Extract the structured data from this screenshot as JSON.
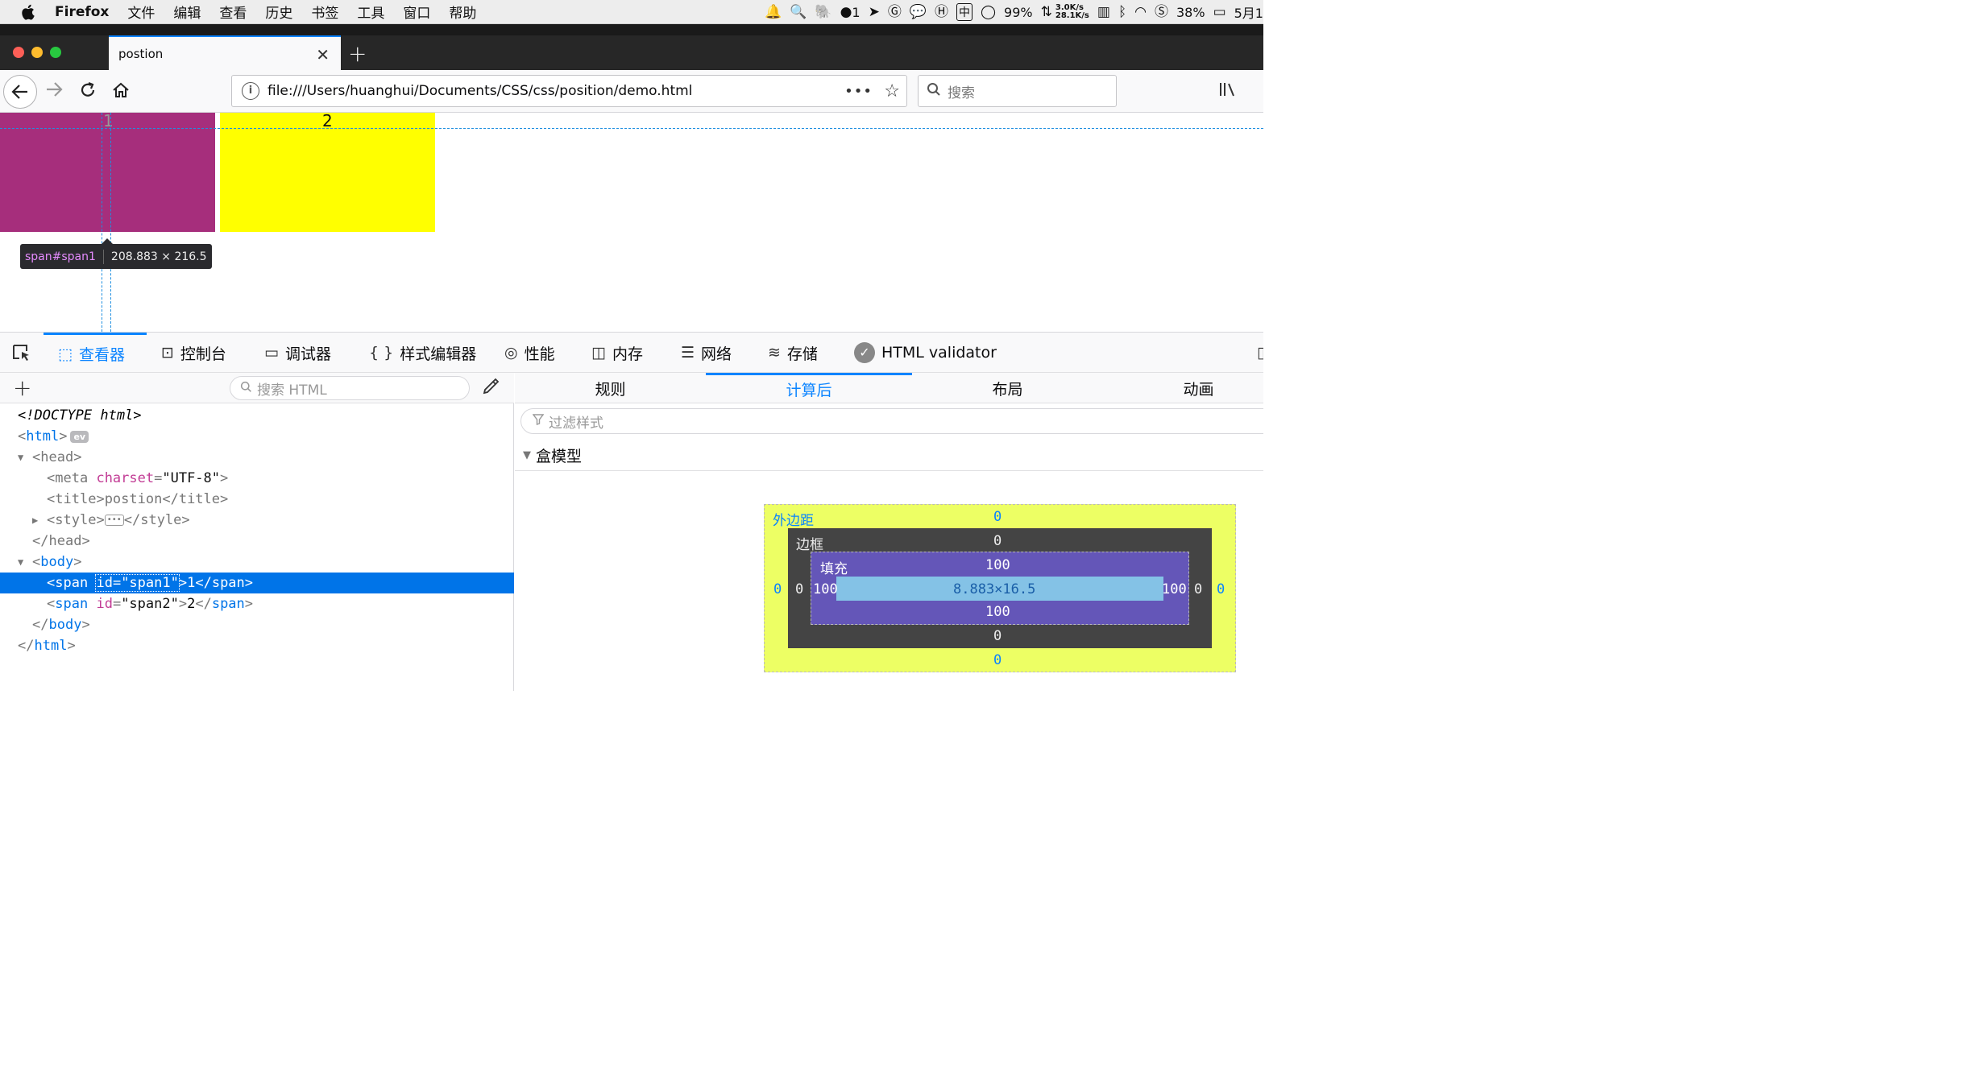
{
  "menubar": {
    "app": "Firefox",
    "items": [
      "文件",
      "编辑",
      "查看",
      "历史",
      "书签",
      "工具",
      "窗口",
      "帮助"
    ],
    "status": {
      "badge": "1",
      "cpu": "99%",
      "net_up": "3.0K/s",
      "net_down": "28.1K/s",
      "ime": "中",
      "battery": "38%",
      "date": "5月1"
    }
  },
  "browser": {
    "tab_title": "postion",
    "url": "file:///Users/huanghui/Documents/CSS/css/position/demo.html",
    "search_placeholder": "搜索"
  },
  "page": {
    "span1_text": "1",
    "span2_text": "2",
    "span1_color": "#a62e7c",
    "span2_color": "#ffff00"
  },
  "tooltip": {
    "tag": "span",
    "id": "#span1",
    "size": "208.883 × 216.5"
  },
  "devtools": {
    "tabs": [
      {
        "label": "查看器",
        "icon": "inspector-icon"
      },
      {
        "label": "控制台",
        "icon": "console-icon"
      },
      {
        "label": "调试器",
        "icon": "debugger-icon"
      },
      {
        "label": "样式编辑器",
        "icon": "style-editor-icon"
      },
      {
        "label": "性能",
        "icon": "performance-icon"
      },
      {
        "label": "内存",
        "icon": "memory-icon"
      },
      {
        "label": "网络",
        "icon": "network-icon"
      },
      {
        "label": "存储",
        "icon": "storage-icon"
      },
      {
        "label": "HTML validator",
        "icon": "validator-icon"
      }
    ],
    "search_html_placeholder": "搜索 HTML",
    "tree": [
      {
        "kind": "doctype",
        "text": "<!DOCTYPE html>"
      },
      {
        "kind": "open",
        "tag": "html",
        "badge": "ev"
      },
      {
        "kind": "open",
        "tag": "head"
      },
      {
        "kind": "meta",
        "tag": "meta",
        "attr": "charset",
        "value": "\"UTF-8\""
      },
      {
        "kind": "title",
        "tag": "title",
        "content": "postion"
      },
      {
        "kind": "style",
        "tag": "style"
      },
      {
        "kind": "close",
        "tag": "head"
      },
      {
        "kind": "open",
        "tag": "body"
      },
      {
        "kind": "span",
        "tag": "span",
        "attr": "id",
        "value": "\"span1\"",
        "content": "1"
      },
      {
        "kind": "span",
        "tag": "span",
        "attr": "id",
        "value": "\"span2\"",
        "content": "2"
      },
      {
        "kind": "close",
        "tag": "body"
      },
      {
        "kind": "close",
        "tag": "html"
      }
    ],
    "right_tabs": [
      "规则",
      "计算后",
      "布局",
      "动画"
    ],
    "filter_placeholder": "过滤样式",
    "section_title": "盒模型",
    "boxmodel": {
      "margin_label": "外边距",
      "border_label": "边框",
      "padding_label": "填充",
      "margin": {
        "top": "0",
        "right": "0",
        "bottom": "0",
        "left": "0"
      },
      "border": {
        "top": "0",
        "right": "0",
        "bottom": "0",
        "left": "0"
      },
      "padding": {
        "top": "100",
        "right": "100",
        "bottom": "100",
        "left": "100"
      },
      "content": "8.883×16.5"
    }
  }
}
